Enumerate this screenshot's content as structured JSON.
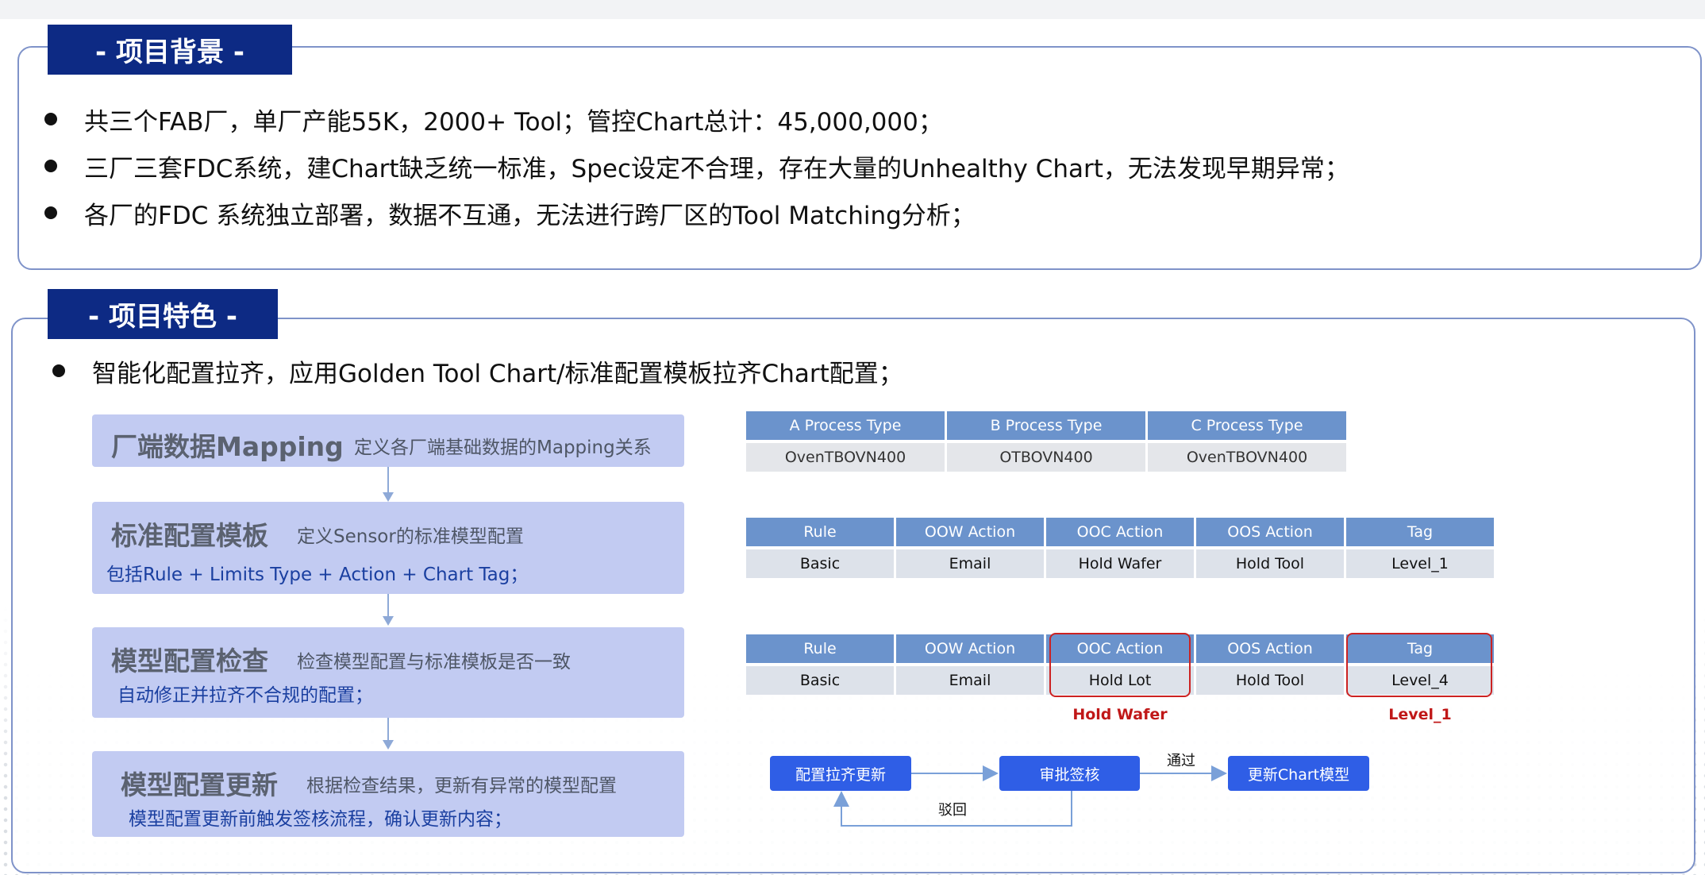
{
  "background": {
    "tag": "- 项目背景 -",
    "bullets": [
      "共三个FAB厂，单厂产能55K，2000+ Tool；管控Chart总计：45,000,000；",
      "三厂三套FDC系统，建Chart缺乏统一标准，Spec设定不合理，存在大量的Unhealthy Chart，无法发现早期异常；",
      "各厂的FDC 系统独立部署，数据不互通，无法进行跨厂区的Tool Matching分析；"
    ]
  },
  "features": {
    "tag": "- 项目特色 -",
    "bullet": "智能化配置拉齐，应用Golden Tool Chart/标准配置模板拉齐Chart配置；",
    "steps": [
      {
        "title": "厂端数据Mapping",
        "desc": "定义各厂端基础数据的Mapping关系",
        "sub": ""
      },
      {
        "title": "标准配置模板",
        "desc": "定义Sensor的标准模型配置",
        "sub": "包括Rule + Limits Type + Action + Chart Tag；"
      },
      {
        "title": "模型配置检查",
        "desc": "检查模型配置与标准模板是否一致",
        "sub": "自动修正并拉齐不合规的配置；"
      },
      {
        "title": "模型配置更新",
        "desc": "根据检查结果，更新有异常的模型配置",
        "sub": "模型配置更新前触发签核流程，确认更新内容；"
      }
    ],
    "process_table": {
      "headers": [
        "A Process Type",
        "B Process Type",
        "C Process Type"
      ],
      "row": [
        "OvenTBOVN400",
        "OTBOVN400",
        "OvenTBOVN400"
      ]
    },
    "template_table": {
      "headers": [
        "Rule",
        "OOW Action",
        "OOC Action",
        "OOS Action",
        "Tag"
      ],
      "row": [
        "Basic",
        "Email",
        "Hold Wafer",
        "Hold Tool",
        "Level_1"
      ]
    },
    "check_table": {
      "headers": [
        "Rule",
        "OOW Action",
        "OOC Action",
        "OOS Action",
        "Tag"
      ],
      "row": [
        "Basic",
        "Email",
        "Hold Lot",
        "Hold Tool",
        "Level_4"
      ],
      "corrections": {
        "ooc": "Hold Wafer",
        "tag": "Level_1"
      }
    },
    "flow": {
      "step1": "配置拉齐更新",
      "step2": "审批签核",
      "step3": "更新Chart模型",
      "pass_label": "通过",
      "reject_label": "驳回"
    }
  },
  "colors": {
    "tag_bg": "#0d2a84",
    "panel_border": "#7f93c9",
    "step_bg": "#c2cbf2",
    "table_header": "#6b93cc",
    "highlight_red": "#cc2222",
    "flow_button": "#2f5ee6"
  }
}
